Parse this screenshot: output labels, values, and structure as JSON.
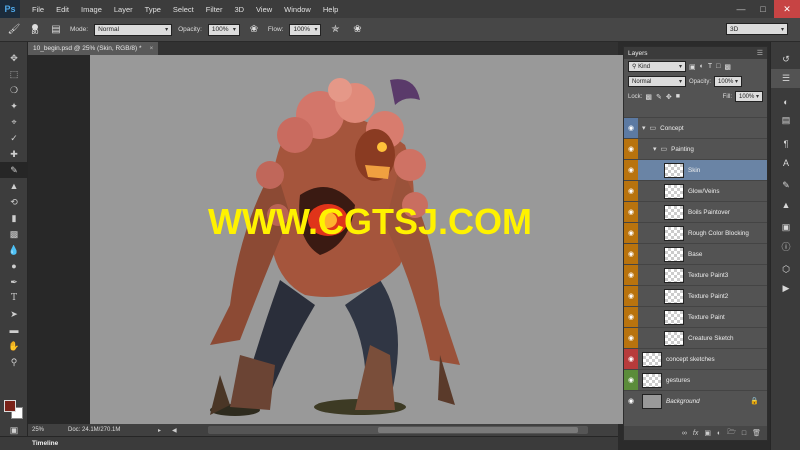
{
  "app": {
    "logo": "Ps"
  },
  "menu": [
    "File",
    "Edit",
    "Image",
    "Layer",
    "Type",
    "Select",
    "Filter",
    "3D",
    "View",
    "Window",
    "Help"
  ],
  "options": {
    "brush_size": "80",
    "mode_label": "Mode:",
    "mode_value": "Normal",
    "opacity_label": "Opacity:",
    "opacity_value": "100%",
    "flow_label": "Flow:",
    "flow_value": "100%",
    "workspace": "3D"
  },
  "document": {
    "tab_title": "10_begin.psd @ 25% (Skin, RGB/8) *",
    "watermark": "WWW.CGTSJ.COM"
  },
  "status": {
    "zoom": "25%",
    "doc_info": "Doc: 24.1M/270.1M"
  },
  "timeline": {
    "label": "Timeline"
  },
  "layers_panel": {
    "title": "Layers",
    "filter_value": "Kind",
    "blend_value": "Normal",
    "opacity_label": "Opacity:",
    "opacity_value": "100%",
    "lock_label": "Lock:",
    "fill_label": "Fill:",
    "fill_value": "100%",
    "layers": [
      {
        "name": "Concept",
        "type": "group",
        "indent": 0,
        "color": "#5c7aa3"
      },
      {
        "name": "Painting",
        "type": "group",
        "indent": 1,
        "color": "#b8730e"
      },
      {
        "name": "Skin",
        "type": "layer",
        "indent": 2,
        "color": "#b8730e",
        "selected": true
      },
      {
        "name": "Glow/Veins",
        "type": "layer",
        "indent": 2,
        "color": "#b8730e"
      },
      {
        "name": "Boils Paintover",
        "type": "layer",
        "indent": 2,
        "color": "#b8730e"
      },
      {
        "name": "Rough Color Blocking",
        "type": "layer",
        "indent": 2,
        "color": "#b8730e"
      },
      {
        "name": "Base",
        "type": "layer",
        "indent": 2,
        "color": "#b8730e"
      },
      {
        "name": "Texture Paint3",
        "type": "layer",
        "indent": 2,
        "color": "#b8730e"
      },
      {
        "name": "Texture Paint2",
        "type": "layer",
        "indent": 2,
        "color": "#b8730e"
      },
      {
        "name": "Texture Paint",
        "type": "layer",
        "indent": 2,
        "color": "#b8730e"
      },
      {
        "name": "Creature Sketch",
        "type": "layer",
        "indent": 2,
        "color": "#b8730e"
      },
      {
        "name": "concept sketches",
        "type": "layer",
        "indent": 0,
        "color": "#b73b3b"
      },
      {
        "name": "gestures",
        "type": "layer",
        "indent": 0,
        "color": "#5b8c3a"
      },
      {
        "name": "Background",
        "type": "background",
        "indent": 0,
        "color": "#535353"
      }
    ]
  },
  "colors": {
    "foreground": "#7a2218",
    "background": "#ffffff",
    "selection": "#6a84a5",
    "watermark": "#fff200"
  },
  "icons": {
    "tools": [
      "move-icon",
      "marquee-icon",
      "lasso-icon",
      "quick-select-icon",
      "crop-icon",
      "eyedropper-icon",
      "healing-icon",
      "brush-icon",
      "stamp-icon",
      "history-brush-icon",
      "eraser-icon",
      "gradient-icon",
      "blur-icon",
      "dodge-icon",
      "pen-icon",
      "type-icon",
      "path-select-icon",
      "rectangle-icon",
      "hand-icon",
      "zoom-icon"
    ],
    "dock": [
      "history-icon",
      "layers-icon",
      "adjustments-icon",
      "properties-icon",
      "paragraph-icon",
      "character-icon",
      "brush-panel-icon",
      "clone-source-icon",
      "styles-icon",
      "info-icon",
      "3d-icon",
      "actions-icon"
    ]
  }
}
